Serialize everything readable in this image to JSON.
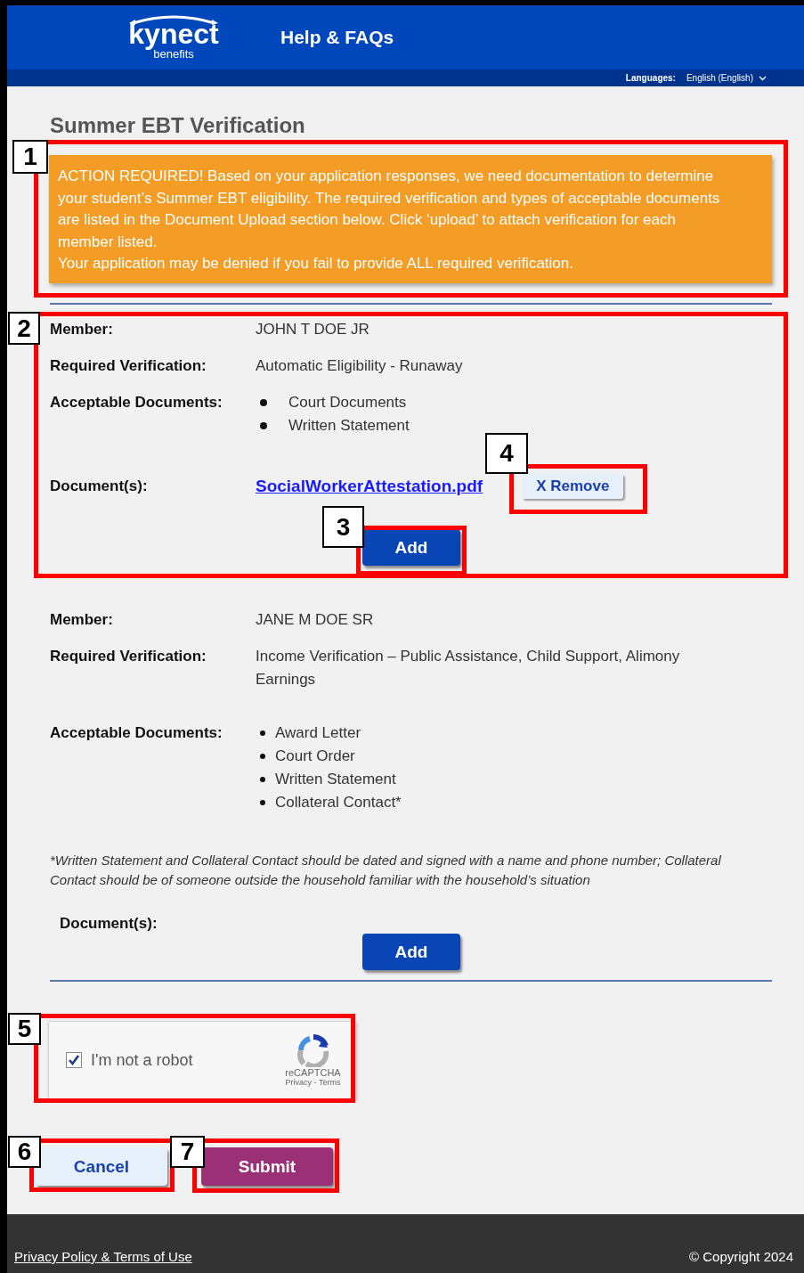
{
  "header": {
    "logo_text": "kynect",
    "logo_subtext": "benefits",
    "nav_link": "Help & FAQs",
    "languages_label": "Languages:",
    "language_value": "English (English)"
  },
  "page_title": "Summer EBT Verification",
  "alert": {
    "lines": [
      "ACTION REQUIRED! Based on your application responses, we need documentation to determine your student’s Summer EBT eligibility. The required verification and types of acceptable documents are listed in the Document Upload section below.  Click ‘upload’ to attach verification for each member listed.",
      "Your application may be denied if you fail to provide ALL required verification."
    ]
  },
  "members": [
    {
      "member_label": "Member:",
      "member": "JOHN T DOE JR",
      "verification_label": "Required Verification:",
      "verification": "Automatic Eligibility - Runaway",
      "documents_label": "Acceptable Documents:",
      "wide_bullets": true,
      "acceptable_documents": [
        "Court Documents",
        "Written Statement"
      ],
      "uploads_label": "Document(s):",
      "uploads": [
        {
          "file": "SocialWorkerAttestation.pdf",
          "remove_label": "X Remove"
        }
      ],
      "add_label": "Add"
    },
    {
      "member_label": "Member:",
      "member": "JANE M DOE SR",
      "verification_label": "Required Verification:",
      "verification": "Income Verification – Public Assistance, Child Support, Alimony Earnings",
      "documents_label": "Acceptable Documents:",
      "wide_bullets": false,
      "acceptable_documents": [
        "Award Letter",
        "Court Order",
        "Written Statement",
        "Collateral Contact*"
      ],
      "note": "*Written Statement and Collateral Contact should be dated and signed with a name and phone number; Collateral Contact should be of someone outside the household familiar with the household’s situation",
      "uploads_label": "Document(s):",
      "add_label": "Add"
    }
  ],
  "captcha": {
    "checked": true,
    "label": "I'm not a robot",
    "brand": "reCAPTCHA",
    "links": "Privacy - Terms"
  },
  "buttons": {
    "cancel": "Cancel",
    "submit": "Submit"
  },
  "footer": {
    "link": "Privacy Policy & Terms of Use",
    "copyright": "© Copyright 2024"
  },
  "annotations": [
    {
      "number": "1"
    },
    {
      "number": "2"
    },
    {
      "number": "3"
    },
    {
      "number": "4"
    },
    {
      "number": "5"
    },
    {
      "number": "6"
    },
    {
      "number": "7"
    }
  ]
}
